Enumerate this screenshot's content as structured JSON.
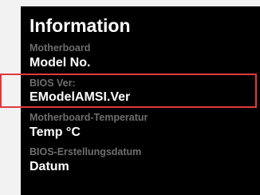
{
  "panel": {
    "title": "Information",
    "fields": [
      {
        "label": "Motherboard",
        "value": "Model No."
      },
      {
        "label": "BIOS Ver:",
        "value": "EModelAMSI.Ver"
      },
      {
        "label": "Motherboard-Temperatur",
        "value": "Temp °C"
      },
      {
        "label": "BIOS-Erstellungsdatum",
        "value": "Datum"
      }
    ]
  },
  "colors": {
    "panel_background": "#000000",
    "label_text": "#6e6e6e",
    "value_text": "#ffffff",
    "highlight_border": "#e0393e",
    "page_background": "#f2f2f2"
  }
}
